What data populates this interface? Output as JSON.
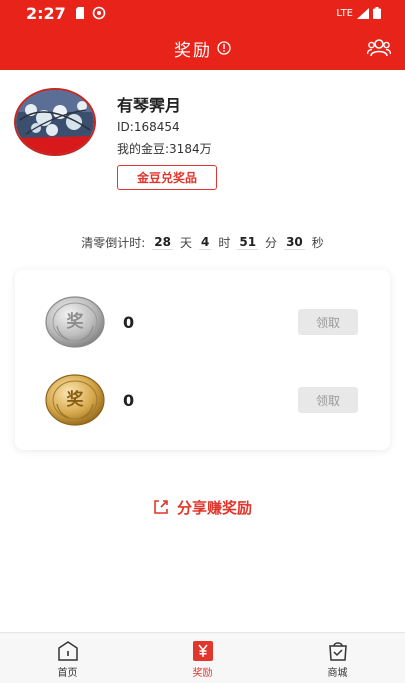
{
  "status_bar": {
    "time": "2:27",
    "network": "LTE"
  },
  "header": {
    "title": "奖励"
  },
  "profile": {
    "name": "有琴霁月",
    "id_text": "ID:168454",
    "coins_text": "我的金豆:3184万",
    "redeem_label": "金豆兑奖品"
  },
  "countdown": {
    "label": "清零倒计时:",
    "days": "28",
    "days_unit": "天",
    "hours": "4",
    "hours_unit": "时",
    "minutes": "51",
    "minutes_unit": "分",
    "seconds": "30",
    "seconds_unit": "秒"
  },
  "rewards": [
    {
      "medal_glyph": "奖",
      "count": "0",
      "claim_label": "领取"
    },
    {
      "medal_glyph": "奖",
      "count": "0",
      "claim_label": "领取"
    }
  ],
  "share": {
    "label": "分享赚奖励"
  },
  "tabs": [
    {
      "label": "首页"
    },
    {
      "label": "奖励"
    },
    {
      "label": "商城"
    }
  ],
  "colors": {
    "brand_red": "#e8231a",
    "accent_red": "#e0362c",
    "disabled_gray": "#e8e8e8"
  }
}
